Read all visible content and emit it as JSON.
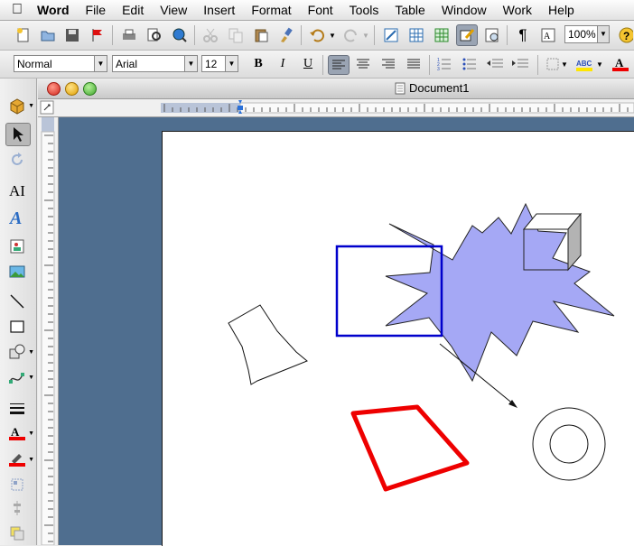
{
  "menubar": {
    "app": "Word",
    "items": [
      "File",
      "Edit",
      "View",
      "Insert",
      "Format",
      "Font",
      "Tools",
      "Table",
      "Window",
      "Work",
      "Help"
    ]
  },
  "toolbar": {
    "zoom": "100%"
  },
  "formatting": {
    "style": "Normal",
    "font": "Arial",
    "size": "12",
    "bold": "B",
    "italic": "I",
    "underline": "U"
  },
  "window": {
    "title": "Document1"
  },
  "colors": {
    "starburst_fill": "#a5a8f5",
    "rectangle_stroke": "#0000cc",
    "quad_stroke": "#ee0000",
    "desktop_blue": "#4f6e8f"
  }
}
